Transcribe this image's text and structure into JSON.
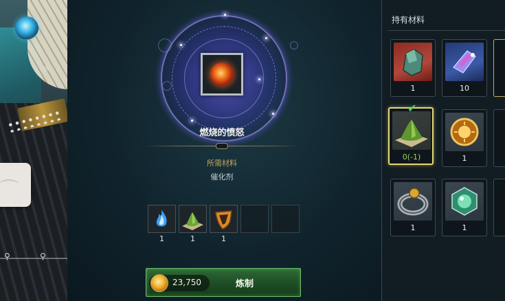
{
  "craft": {
    "result_name": "燃烧的愤怒",
    "required_title": "所需材料",
    "required_sub": "催化剂",
    "materials": [
      {
        "icon": "blue-flame-icon",
        "qty": "1"
      },
      {
        "icon": "green-pile-icon",
        "qty": "1"
      },
      {
        "icon": "orange-shield-icon",
        "qty": "1"
      },
      {
        "icon": "empty-slot",
        "qty": ""
      },
      {
        "icon": "empty-slot",
        "qty": ""
      }
    ],
    "cost": "23,750",
    "button_label": "炼制"
  },
  "inventory": {
    "title": "持有材料",
    "items": [
      {
        "icon": "jade-shard-icon",
        "qty": "1"
      },
      {
        "icon": "crystal-gem-icon",
        "qty": "10"
      },
      {
        "icon": "green-pile-icon",
        "qty": "0(-1)",
        "selected": true
      },
      {
        "icon": "sun-medallion-icon",
        "qty": "1"
      },
      {
        "icon": "silver-ring-icon",
        "qty": "1"
      },
      {
        "icon": "green-orb-icon",
        "qty": "1"
      }
    ]
  },
  "colors": {
    "accent_gold": "#c9a25b",
    "button_green": "#2e6a35",
    "selected_border": "#e6d878",
    "partial_qty_green": "#9bd64f"
  }
}
